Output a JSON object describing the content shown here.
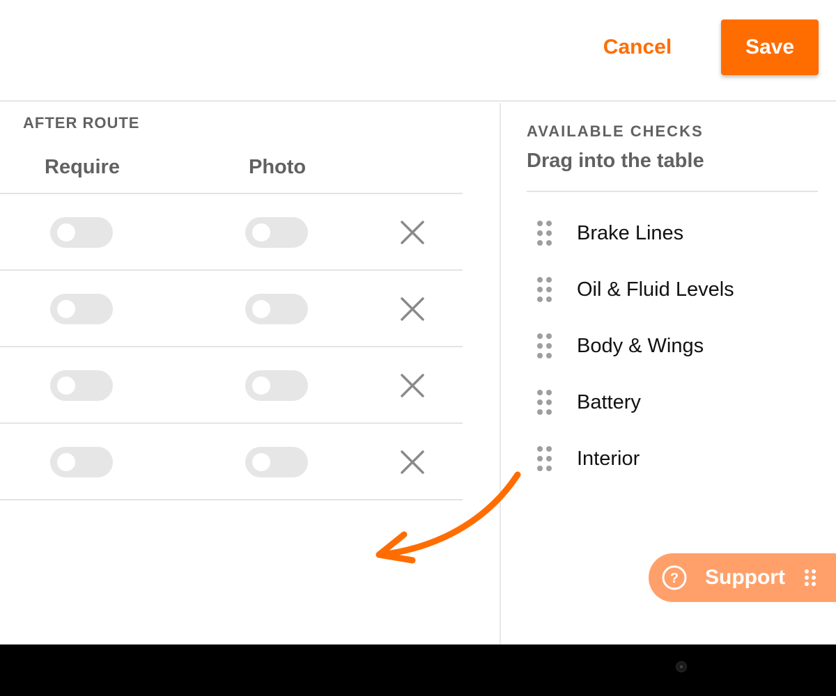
{
  "header": {
    "cancel_label": "Cancel",
    "save_label": "Save"
  },
  "after_route": {
    "section_title": "AFTER ROUTE",
    "columns": [
      "Require",
      "Photo"
    ],
    "rows": [
      {
        "require": false,
        "photo": false
      },
      {
        "require": false,
        "photo": false
      },
      {
        "require": false,
        "photo": false
      },
      {
        "require": false,
        "photo": false
      }
    ]
  },
  "available_checks": {
    "title": "AVAILABLE CHECKS",
    "subtitle": "Drag into the table",
    "items": [
      {
        "label": "Brake Lines"
      },
      {
        "label": "Oil & Fluid Levels"
      },
      {
        "label": "Body & Wings"
      },
      {
        "label": "Battery"
      },
      {
        "label": "Interior"
      }
    ]
  },
  "support": {
    "label": "Support",
    "icon": "help-circle-icon"
  },
  "colors": {
    "accent": "#ff6d00",
    "support_bg": "#ffa06a",
    "toggle_off": "#e6e6e6"
  }
}
